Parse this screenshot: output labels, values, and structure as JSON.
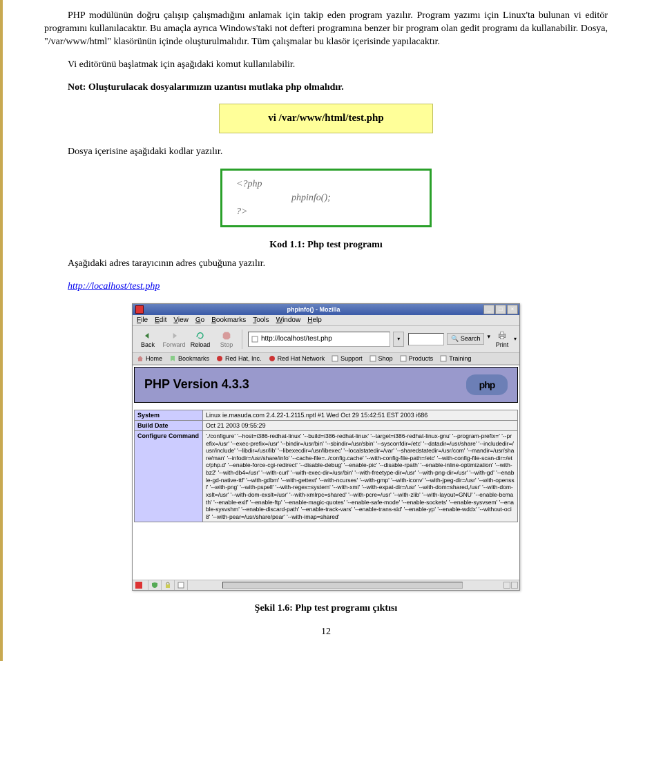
{
  "para1": "PHP modülünün doğru çalışıp çalışmadığını anlamak için takip eden program yazılır. Program yazımı için Linux'ta bulunan vi editör programını kullanılacaktır. Bu amaçla ayrıca Windows'taki not defteri programına benzer bir program olan gedit programı da kullanabilir. Dosya, \"/var/www/html\" klasörünün içinde oluşturulmalıdır. Tüm çalışmalar bu klasör içerisinde yapılacaktır.",
  "para2": "Vi editörünü başlatmak için aşağıdaki komut kullanılabilir.",
  "para3": "Not: Oluşturulacak dosyalarımızın uzantısı mutlaka php olmalıdır.",
  "cmd1": "vi  /var/www/html/test.php",
  "para4": "Dosya içerisine aşağıdaki kodlar yazılır.",
  "code2": {
    "l1": "<?php",
    "l2": "phpinfo();",
    "l3": "?>"
  },
  "caption1": "Kod 1.1: Php test programı",
  "para5": "Aşağıdaki adres tarayıcının adres çubuğuna yazılır.",
  "link": "http://localhost/test.php",
  "browser": {
    "title": "phpinfo() - Mozilla",
    "menu": [
      "File",
      "Edit",
      "View",
      "Go",
      "Bookmarks",
      "Tools",
      "Window",
      "Help"
    ],
    "nav": {
      "back": "Back",
      "forward": "Forward",
      "reload": "Reload",
      "stop": "Stop",
      "url": "http://localhost/test.php",
      "search": "Search",
      "print": "Print"
    },
    "bm": [
      "Home",
      "Bookmarks",
      "Red Hat, Inc.",
      "Red Hat Network",
      "Support",
      "Shop",
      "Products",
      "Training"
    ],
    "phpver": "PHP Version 4.3.3",
    "phplogo": "php",
    "rows": [
      {
        "h": "System",
        "d": "Linux ie.masuda.com 2.4.22-1.2115.nptl #1 Wed Oct 29 15:42:51 EST 2003 i686"
      },
      {
        "h": "Build Date",
        "d": "Oct 21 2003 09:55:29"
      },
      {
        "h": "Configure Command",
        "d": "'./configure' '--host=i386-redhat-linux' '--build=i386-redhat-linux' '--target=i386-redhat-linux-gnu' '--program-prefix=' '--prefix=/usr' '--exec-prefix=/usr' '--bindir=/usr/bin' '--sbindir=/usr/sbin' '--sysconfdir=/etc' '--datadir=/usr/share' '--includedir=/usr/include' '--libdir=/usr/lib' '--libexecdir=/usr/libexec' '--localstatedir=/var' '--sharedstatedir=/usr/com' '--mandir=/usr/share/man' '--infodir=/usr/share/info' '--cache-file=../config.cache' '--with-config-file-path=/etc' '--with-config-file-scan-dir=/etc/php.d' '--enable-force-cgi-redirect' '--disable-debug' '--enable-pic' '--disable-rpath' '--enable-inline-optimization' '--with-bz2' '--with-db4=/usr' '--with-curl' '--with-exec-dir=/usr/bin' '--with-freetype-dir=/usr' '--with-png-dir=/usr' '--with-gd' '--enable-gd-native-ttf' '--with-gdbm' '--with-gettext' '--with-ncurses' '--with-gmp' '--with-iconv' '--with-jpeg-dir=/usr' '--with-openssl' '--with-png' '--with-pspell' '--with-regex=system' '--with-xml' '--with-expat-dir=/usr' '--with-dom=shared,/usr' '--with-dom-xslt=/usr' '--with-dom-exslt=/usr' '--with-xmlrpc=shared' '--with-pcre=/usr' '--with-zlib' '--with-layout=GNU' '--enable-bcmath' '--enable-exif' '--enable-ftp' '--enable-magic-quotes' '--enable-safe-mode' '--enable-sockets' '--enable-sysvsem' '--enable-sysvshm' '--enable-discard-path' '--enable-track-vars' '--enable-trans-sid' '--enable-yp' '--enable-wddx' '--without-oci8' '--with-pear=/usr/share/pear' '--with-imap=shared'"
      }
    ]
  },
  "caption2": "Şekil 1.6: Php test programı çıktısı",
  "pagenum": "12"
}
